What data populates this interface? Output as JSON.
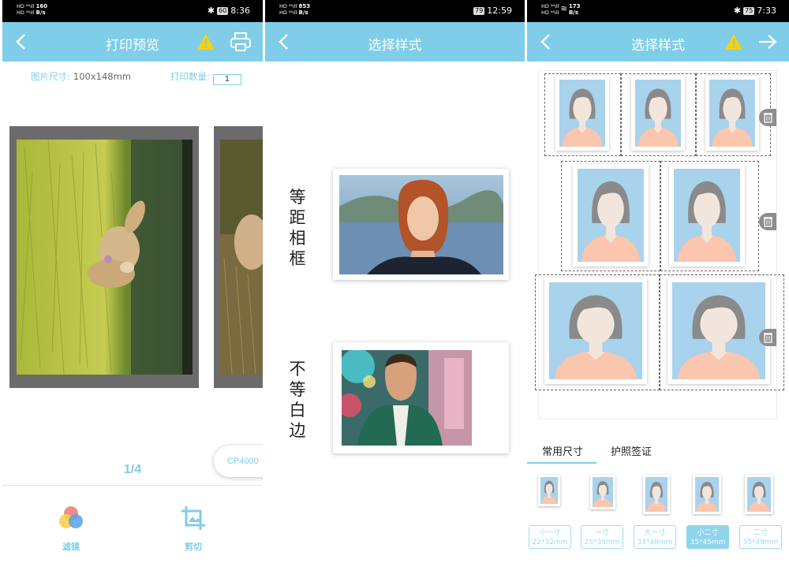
{
  "screen1": {
    "status": {
      "signal_left": "HD 4G",
      "speed": "160",
      "speed_unit": "B/s",
      "battery": "60",
      "time": "8:36"
    },
    "header": {
      "title": "打印预览",
      "back_icon": "back-chevron-icon",
      "warning_icon": "warning-icon",
      "print_icon": "printer-icon"
    },
    "photo_size_label": "图片尺寸:",
    "photo_size_value": "100x148mm",
    "print_qty_label": "打印数量:",
    "print_qty_value": "1",
    "pager": "1/4",
    "printer_model": "CP4000",
    "tools": [
      {
        "label": "滤镜",
        "icon": "filter-icon"
      },
      {
        "label": "剪切",
        "icon": "crop-icon"
      }
    ]
  },
  "screen2": {
    "status": {
      "speed": "853",
      "speed_unit": "B/s",
      "battery": "79",
      "time": "12:59"
    },
    "header": {
      "title": "选择样式",
      "back_icon": "back-chevron-icon"
    },
    "styles": [
      {
        "label_chars": [
          "等",
          "距",
          "相",
          "框"
        ]
      },
      {
        "label_chars": [
          "不",
          "等",
          "白",
          "边"
        ]
      }
    ]
  },
  "screen3": {
    "status": {
      "speed": "173",
      "speed_unit": "B/s",
      "battery": "75",
      "time": "7:33"
    },
    "header": {
      "title": "选择样式",
      "back_icon": "back-chevron-icon",
      "warning_icon": "warning-icon",
      "next_icon": "arrow-right-icon"
    },
    "tabs": [
      {
        "label": "常用尺寸",
        "active": true
      },
      {
        "label": "护照签证",
        "active": false
      }
    ],
    "sizes": [
      {
        "name": "小一寸",
        "dims": "22*32mm",
        "selected": false
      },
      {
        "name": "一寸",
        "dims": "25*35mm",
        "selected": false
      },
      {
        "name": "大一寸",
        "dims": "33*48mm",
        "selected": false
      },
      {
        "name": "小二寸",
        "dims": "35*45mm",
        "selected": true
      },
      {
        "name": "二寸",
        "dims": "35*49mm",
        "selected": false
      }
    ]
  },
  "colors": {
    "accent": "#7fcde8",
    "status_bar": "#000000",
    "preview_frame": "#6b6b6b",
    "id_photo_bg": "#a9d2ec",
    "id_photo_shirt": "#fac6ad",
    "id_photo_hair": "#8a8a8a",
    "id_photo_face": "#f2e6dc"
  }
}
